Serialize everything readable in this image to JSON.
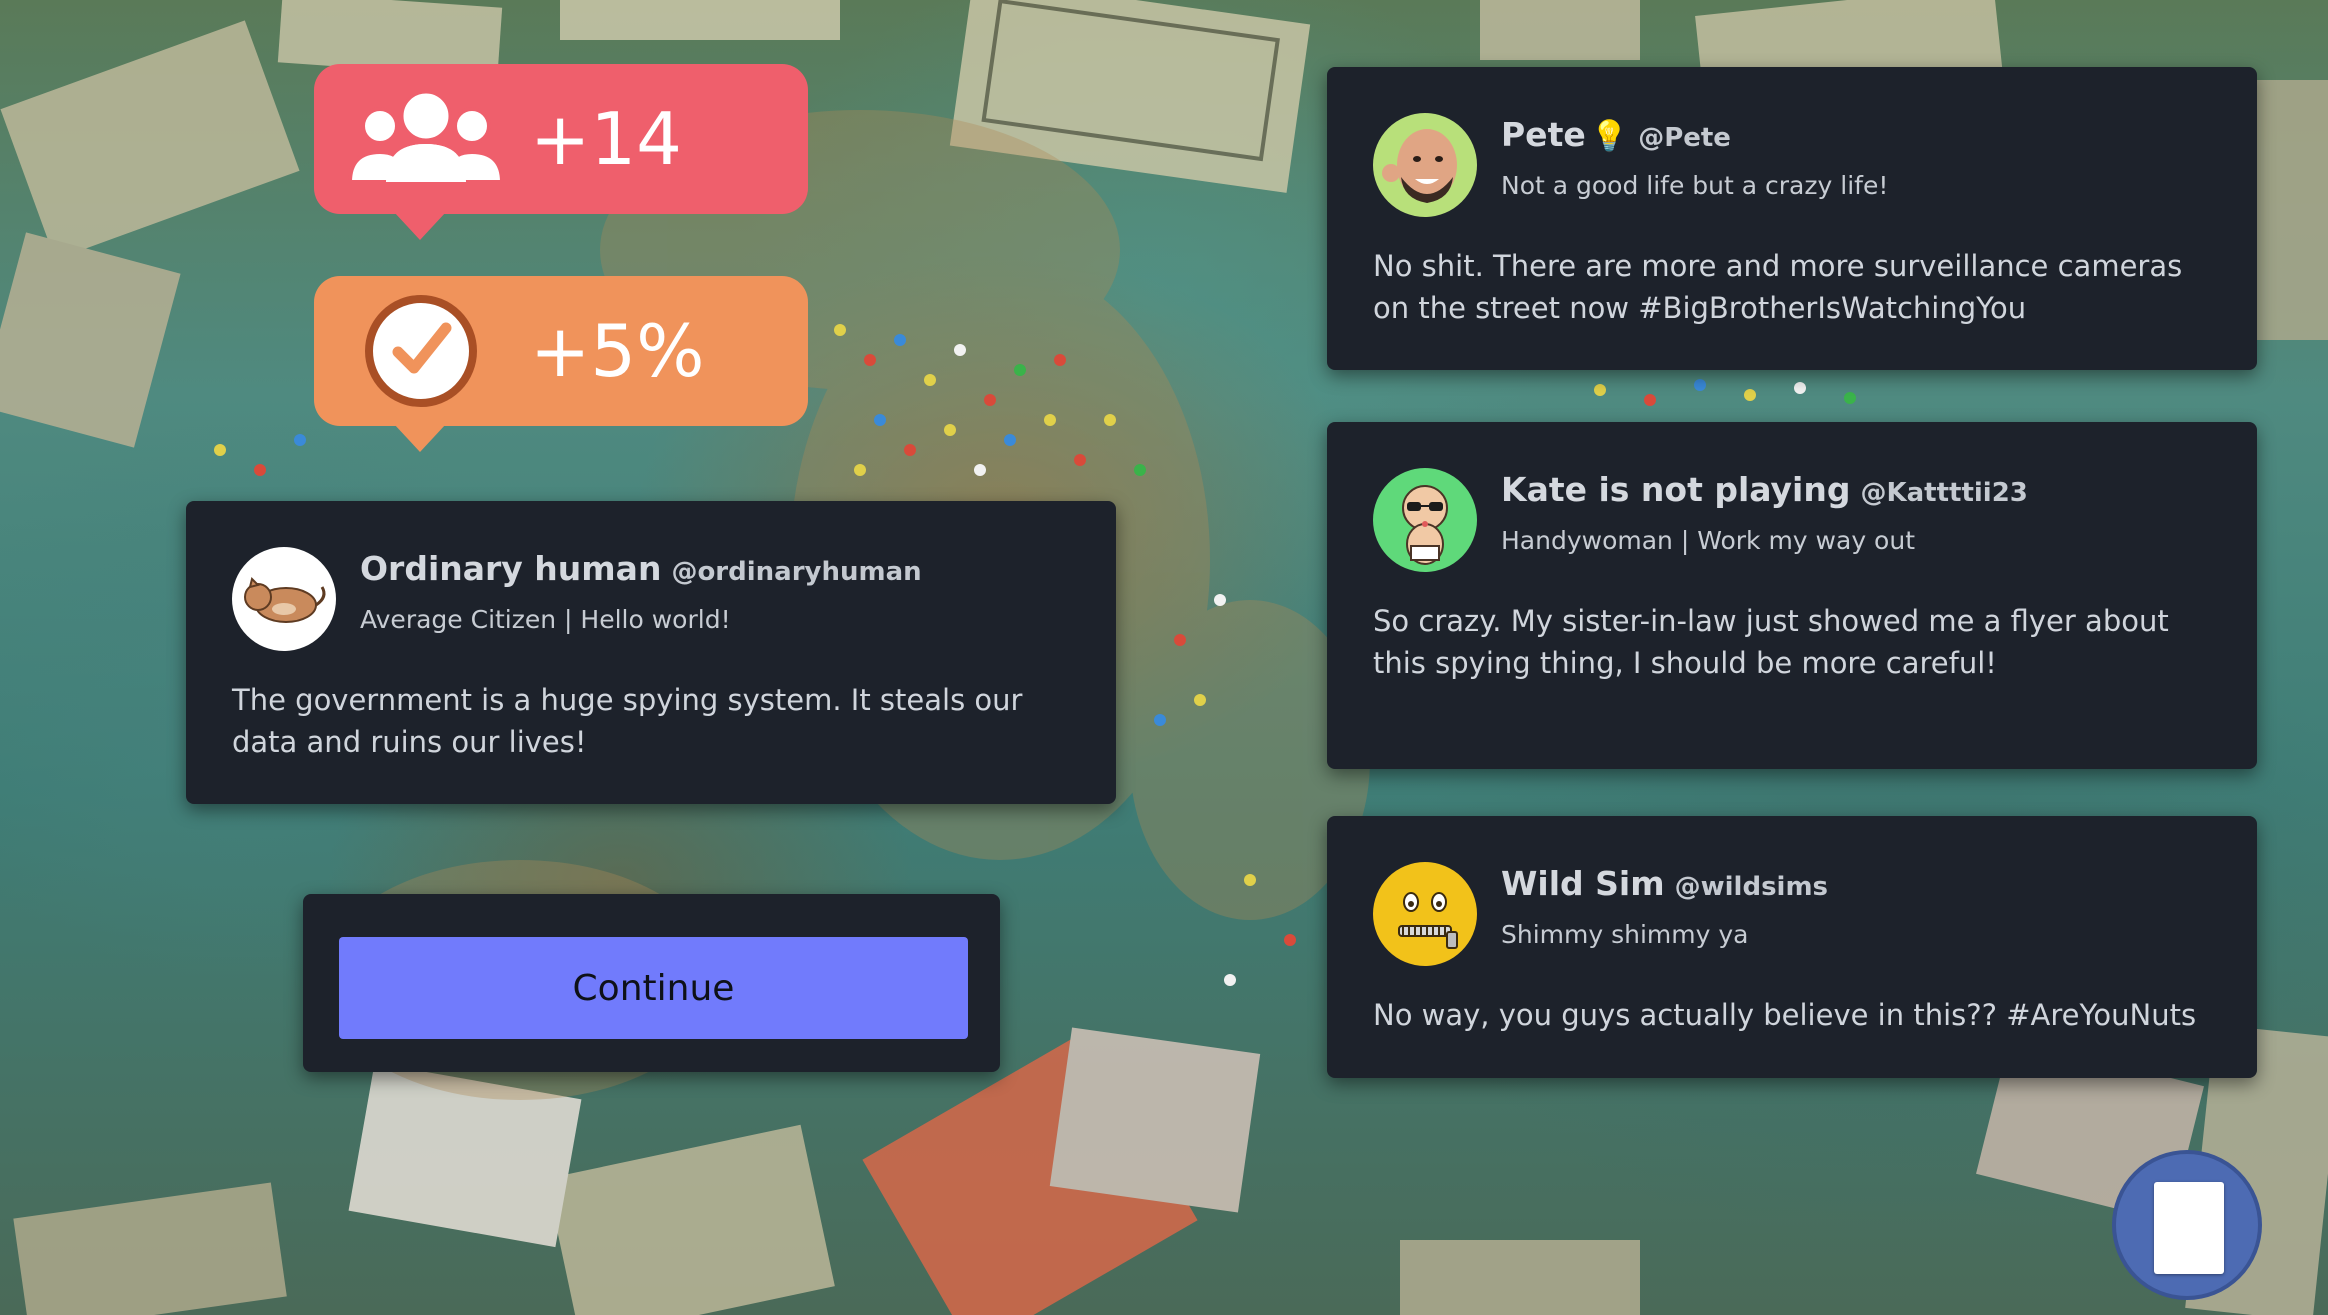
{
  "stats": {
    "followers_change": "+14",
    "trust_change": "+5%"
  },
  "main_post": {
    "name": "Ordinary human",
    "handle": "@ordinaryhuman",
    "bio": "Average Citizen | Hello world!",
    "text": "The government is a huge spying system. It steals our data and ruins our lives!"
  },
  "continue_label": "Continue",
  "replies": [
    {
      "name": "Pete",
      "emoji": "💡",
      "handle": "@Pete",
      "bio": "Not a good life but a crazy life!",
      "text": "No shit. There are more and more surveillance cameras on the street now #BigBrotherIsWatchingYou"
    },
    {
      "name": "Kate is not playing",
      "handle": "@Kattttii23",
      "bio": "Handywoman | Work my way out",
      "text": "So crazy. My sister-in-law just showed me a flyer about this spying thing, I should be more careful!"
    },
    {
      "name": "Wild Sim",
      "handle": "@wildsims",
      "bio": "Shimmy shimmy ya",
      "text": "No way, you guys actually believe in this?? #AreYouNuts"
    }
  ],
  "colors": {
    "followers_badge": "#ef5f6c",
    "trust_badge": "#f0935b",
    "card_bg": "#1d222b",
    "continue_button": "#717bfc",
    "notepad_button": "#4d6bb3"
  }
}
